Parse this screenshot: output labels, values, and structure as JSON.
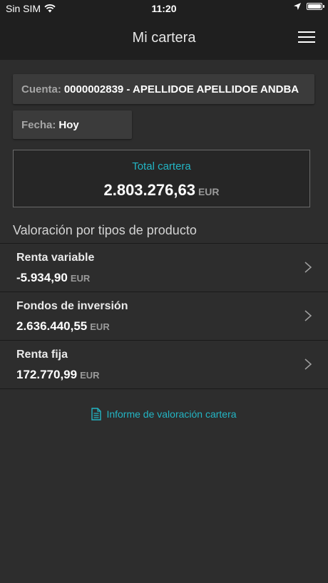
{
  "status_bar": {
    "carrier": "Sin SIM",
    "time": "11:20",
    "icons": [
      "wifi-icon",
      "location-arrow-icon",
      "battery-icon"
    ]
  },
  "nav": {
    "title": "Mi cartera",
    "menu_icon": "hamburger-menu-icon"
  },
  "cuenta": {
    "label": "Cuenta:",
    "value": "0000002839 - APELLIDOE APELLIDOE ANDBA"
  },
  "fecha": {
    "label": "Fecha:",
    "value": "Hoy"
  },
  "total": {
    "label": "Total cartera",
    "value": "2.803.276,63",
    "currency": "EUR"
  },
  "section": {
    "title": "Valoración por tipos de producto"
  },
  "products": [
    {
      "name": "Renta variable",
      "value": "-5.934,90",
      "currency": "EUR"
    },
    {
      "name": "Fondos de inversión",
      "value": "2.636.440,55",
      "currency": "EUR"
    },
    {
      "name": "Renta fija",
      "value": "172.770,99",
      "currency": "EUR"
    }
  ],
  "report": {
    "label": "Informe de valoración cartera",
    "icon": "document-icon"
  },
  "colors": {
    "accent": "#23b5c4",
    "background": "#2d2d2d",
    "bar": "#1f1f1f"
  }
}
